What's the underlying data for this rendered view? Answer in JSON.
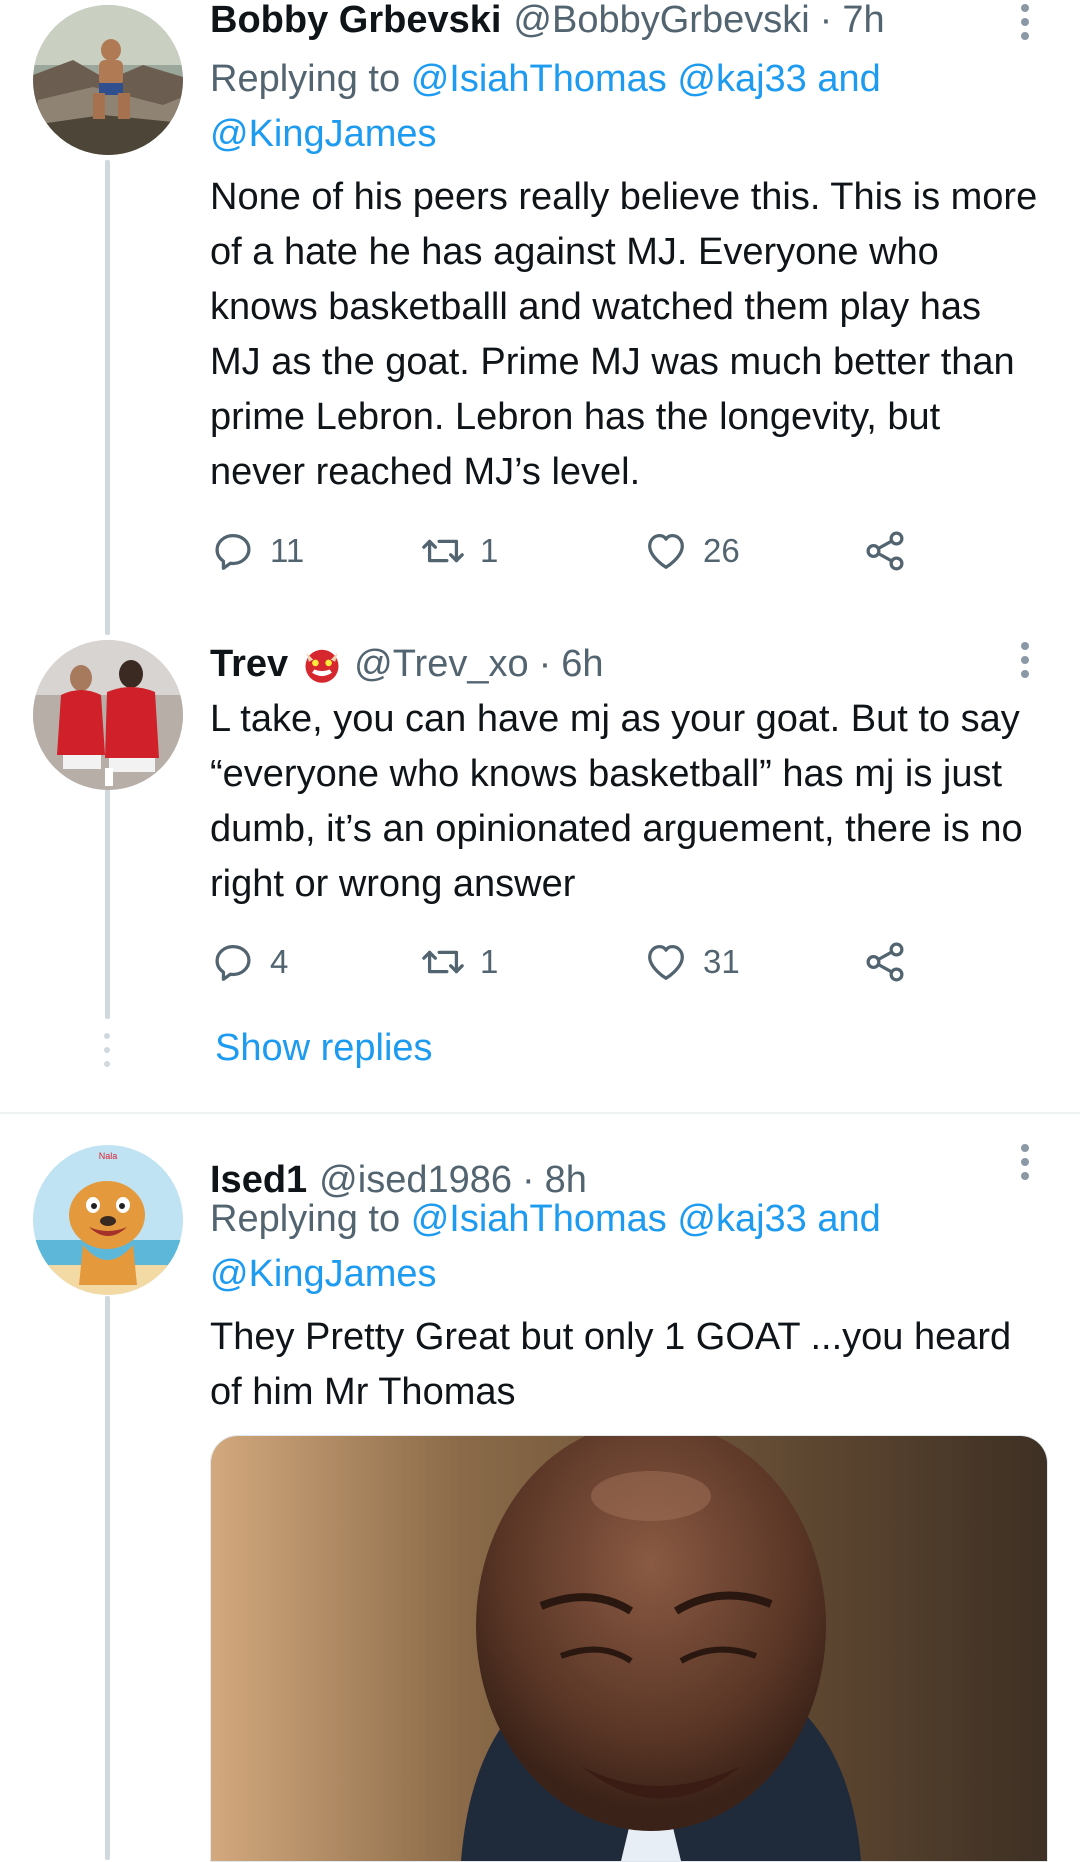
{
  "tweets": [
    {
      "name": "Bobby Grbevski",
      "handle": "@BobbyGrbevski",
      "separator": "·",
      "time": "7h",
      "replying_prefix": "Replying to",
      "mention1": "@IsiahThomas",
      "mention2": "@kaj33",
      "replying_and": "and",
      "mention3": "@KingJames",
      "text": "None of his peers really believe this. This is more of a hate he has against MJ. Everyone who knows basketballl and watched them play has MJ as the goat. Prime MJ was much better than prime Lebron. Lebron has the longevity, but never reached MJ’s level.",
      "replies": "11",
      "retweets": "1",
      "likes": "26"
    },
    {
      "name": "Trev",
      "handle": "@Trev_xo",
      "separator": "·",
      "time": "6h",
      "text": "L take, you can have mj as your goat. But to say “everyone who knows basketball” has mj is just dumb, it’s an opinionated arguement, there is no right or wrong answer",
      "replies": "4",
      "retweets": "1",
      "likes": "31",
      "show_replies": "Show replies"
    },
    {
      "name": "Ised1",
      "handle": "@ised1986",
      "separator": "·",
      "time": "8h",
      "replying_prefix": "Replying to",
      "mention1": "@IsiahThomas",
      "mention2": "@kaj33",
      "replying_and": "and",
      "mention3": "@KingJames",
      "text": "They Pretty Great but only 1 GOAT ...you heard of him Mr Thomas",
      "avatar_caption": "Nala"
    }
  ],
  "colors": {
    "link": "#1d9bf0",
    "secondary": "#536471",
    "thread_line": "#cfd9de"
  },
  "icons": [
    "reply-icon",
    "retweet-icon",
    "like-icon",
    "share-icon",
    "more-icon"
  ]
}
